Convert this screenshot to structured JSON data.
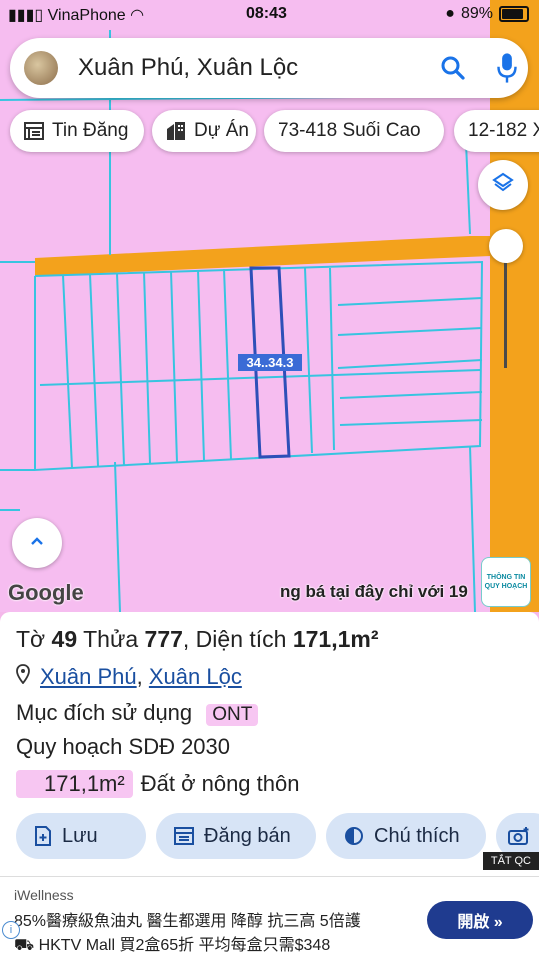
{
  "status_bar": {
    "carrier": "VinaPhone",
    "time": "08:43",
    "battery": "89%",
    "battery_level": 0.89
  },
  "search": {
    "query": "Xuân Phú, Xuân Lộc",
    "icons": [
      "avatar",
      "search-icon",
      "mic-icon"
    ]
  },
  "chips": [
    {
      "label": "Tin Đăng",
      "icon": "newspaper-icon"
    },
    {
      "label": "Dự Án",
      "icon": "building-icon"
    },
    {
      "label": "73-418 Suối Cao",
      "icon": ""
    },
    {
      "label": "12-182 X",
      "icon": ""
    }
  ],
  "map": {
    "parcel_label": "34..34.3",
    "google_label": "Google",
    "ad_scroll_text": "ng bá tại đây chỉ với 19",
    "planning_badge": "THÔNG TIN QUY HOẠCH",
    "colors": {
      "land": "#f6bdf0",
      "road": "#f3a21c",
      "lines": "#38c4e0",
      "selected": "#2e4fb8"
    }
  },
  "details": {
    "title_prefix": "Tờ",
    "sheet_no": "49",
    "parcel_word": "Thửa",
    "parcel_no": "777",
    "area_label": ", Diện tích",
    "area_value": "171,1m²",
    "location_parts": [
      "Xuân Phú",
      ", ",
      "Xuân Lộc"
    ],
    "purpose_label": "Mục đích sử dụng",
    "purpose_code": "ONT",
    "plan_label": "Quy hoạch SDĐ 2030",
    "area_chip": "171,1m²",
    "land_type": "Đất ở nông thôn"
  },
  "actions": [
    {
      "label": "Lưu",
      "icon": "save-icon"
    },
    {
      "label": "Đăng bán",
      "icon": "listing-icon"
    },
    {
      "label": "Chú thích",
      "icon": "legend-icon"
    }
  ],
  "ad": {
    "close_label": "TẮT QC",
    "brand": "iWellness",
    "line1": "85%醫療級魚油丸 醫生都選用 降醇 抗三高 5倍護",
    "line2": "HKTV Mall 買2盒65折 平均每盒只需$348",
    "button": "開啟 »",
    "info": "i"
  }
}
